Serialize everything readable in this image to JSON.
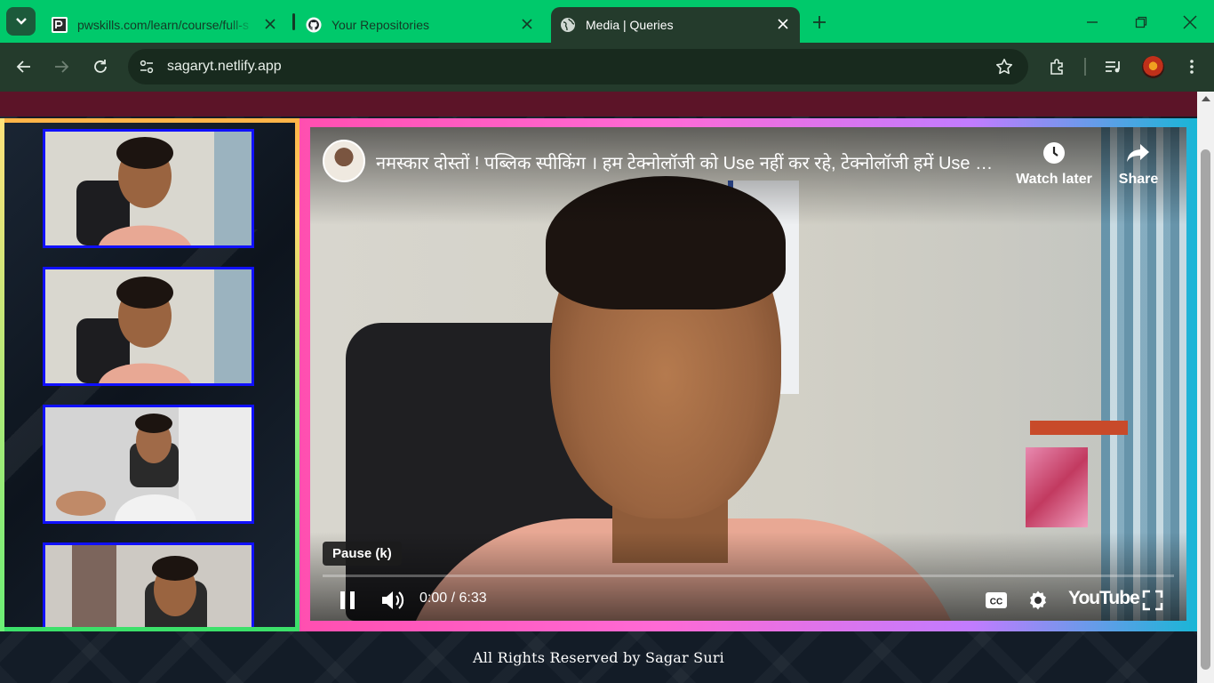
{
  "browser": {
    "tabs": [
      {
        "title": "pwskills.com/learn/course/full-s",
        "icon": "pwskills-favicon",
        "active": false
      },
      {
        "title": "Your Repositories",
        "icon": "github-icon",
        "active": false
      },
      {
        "title": "Media | Queries",
        "icon": "globe-icon",
        "active": true
      }
    ],
    "url": "sagaryt.netlify.app",
    "colors": {
      "tabbar": "#00c96b",
      "toolbar": "#243b2c"
    }
  },
  "page": {
    "thumbnails": [
      {
        "label": "video-thumbnail-1"
      },
      {
        "label": "video-thumbnail-2"
      },
      {
        "label": "video-thumbnail-3"
      },
      {
        "label": "video-thumbnail-4"
      }
    ],
    "player": {
      "title": "नमस्कार दोस्तों ! पब्लिक स्पीकिंग । हम टेक्नोलॉजी को Use नहीं कर रहे, टेक्नोलॉजी हमें Use कर रही है",
      "watch_later": "Watch later",
      "share": "Share",
      "tooltip": "Pause (k)",
      "time": "0:00 / 6:33",
      "progress": 0.0,
      "brand": "YouTube"
    },
    "footer": "All Rights Reserved by Sagar Suri"
  }
}
